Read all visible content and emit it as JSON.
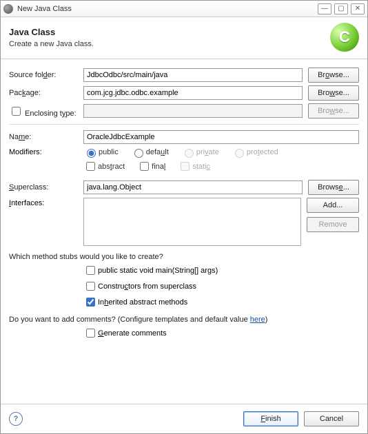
{
  "window": {
    "title": "New Java Class"
  },
  "header": {
    "title": "Java Class",
    "subtitle": "Create a new Java class.",
    "badge": "C"
  },
  "labels": {
    "sourceFolder": "Source folder:",
    "package": "Package:",
    "enclosing": "Enclosing type:",
    "name": "Name:",
    "modifiers": "Modifiers:",
    "superclass": "Superclass:",
    "interfaces": "Interfaces:",
    "whichStubs": "Which method stubs would you like to create?",
    "addCommentsPrefix": "Do you want to add comments? (Configure templates and default value ",
    "hereLink": "here",
    "addCommentsSuffix": ")"
  },
  "fields": {
    "sourceFolder": "JdbcOdbc/src/main/java",
    "package": "com.jcg.jdbc.odbc.example",
    "enclosing": "",
    "name": "OracleJdbcExample",
    "superclass": "java.lang.Object"
  },
  "modifiers": {
    "public": "public",
    "default": "default",
    "private": "private",
    "protected": "protected",
    "abstract": "abstract",
    "final": "final",
    "static": "static"
  },
  "stubs": {
    "main": "public static void main(String[] args)",
    "constructors": "Constructors from superclass",
    "inherited": "Inherited abstract methods",
    "generate": "Generate comments"
  },
  "buttons": {
    "browse": "Browse...",
    "add": "Add...",
    "remove": "Remove",
    "finish": "Finish",
    "cancel": "Cancel"
  }
}
